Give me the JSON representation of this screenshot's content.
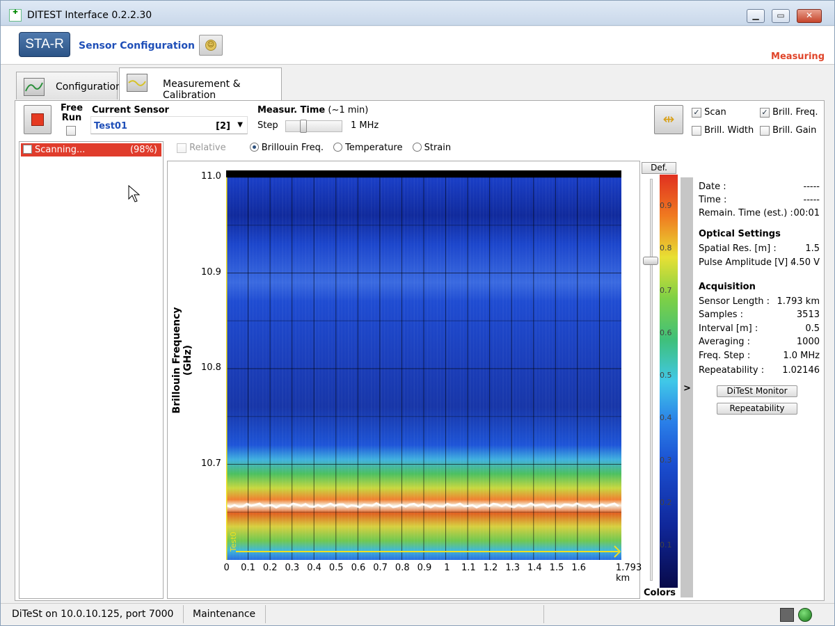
{
  "window": {
    "title": "DITEST Interface 0.2.2.30"
  },
  "header": {
    "brand": "STA-R",
    "section": "Sensor Configuration",
    "status": "Measuring"
  },
  "tabs": [
    {
      "label": "Configuration"
    },
    {
      "label": "Measurement & Calibration",
      "active": true
    }
  ],
  "controls": {
    "free_run_label": "Free Run",
    "current_sensor_label": "Current Sensor",
    "sensor_name": "Test01",
    "sensor_number": "[2]",
    "measur_time_label": "Measur. Time",
    "measur_time_hint": "(~1 min)",
    "step_label": "Step",
    "step_value": "1 MHz"
  },
  "display_options": {
    "scan": {
      "label": "Scan",
      "checked": true
    },
    "brill_freq": {
      "label": "Brill. Freq.",
      "checked": true
    },
    "brill_width": {
      "label": "Brill. Width",
      "checked": false
    },
    "brill_gain": {
      "label": "Brill. Gain",
      "checked": false
    }
  },
  "left_list": {
    "item_label": "Scanning...",
    "item_pct": "(98%)"
  },
  "radios": {
    "relative": "Relative",
    "brillouin": "Brillouin Freq.",
    "temperature": "Temperature",
    "strain": "Strain"
  },
  "chart_data": {
    "type": "heatmap",
    "ylabel": "Brillouin Frequency (GHz)",
    "yticks": [
      "11.0",
      "10.9",
      "10.8",
      "10.7"
    ],
    "ytick_values": [
      11.0,
      10.9,
      10.8,
      10.7
    ],
    "xticks": [
      "0",
      "0.1",
      "0.2",
      "0.3",
      "0.4",
      "0.5",
      "0.6",
      "0.7",
      "0.8",
      "0.9",
      "1",
      "1.1",
      "1.2",
      "1.3",
      "1.4",
      "1.5",
      "1.6",
      "1.793 km"
    ],
    "xtick_values": [
      0,
      0.1,
      0.2,
      0.3,
      0.4,
      0.5,
      0.6,
      0.7,
      0.8,
      0.9,
      1,
      1.1,
      1.2,
      1.3,
      1.4,
      1.5,
      1.6,
      1.793
    ],
    "ylim": [
      10.6,
      11.0
    ],
    "xlim": [
      0,
      1.793
    ],
    "peak_frequency_ghz": 10.657,
    "sensor_tag": "Test0"
  },
  "colorbar": {
    "button": "Def.",
    "label": "Colors",
    "ticks": [
      "0.9",
      "0.8",
      "0.7",
      "0.6",
      "0.5",
      "0.4",
      "0.3",
      "0.2",
      "0.1"
    ]
  },
  "info": {
    "date_label": "Date :",
    "date_value": "-----",
    "time_label": "Time :",
    "time_value": "-----",
    "remain_label": "Remain. Time (est.) :",
    "remain_value": "00:01",
    "optical_head": "Optical Settings",
    "spatial_label": "Spatial Res. [m] :",
    "spatial_value": "1.5",
    "pulse_label": "Pulse Amplitude [V] :",
    "pulse_value": "4.50 V",
    "acq_head": "Acquisition",
    "length_label": "Sensor Length :",
    "length_value": "1.793 km",
    "samples_label": "Samples :",
    "samples_value": "3513",
    "interval_label": "Interval [m] :",
    "interval_value": "0.5",
    "avg_label": "Averaging :",
    "avg_value": "1000",
    "fstep_label": "Freq. Step :",
    "fstep_value": "1.0 MHz",
    "repeat_label": "Repeatability :",
    "repeat_value": "1.02146",
    "monitor_btn": "DiTeSt Monitor",
    "repeat_btn": "Repeatability"
  },
  "statusbar": {
    "connection": "DiTeSt on 10.0.10.125, port 7000",
    "mode": "Maintenance"
  },
  "icons": [
    "app-icon",
    "stop-icon",
    "smile-icon",
    "zoom-icon",
    "network-icon",
    "status-led-icon",
    "config-tab-icon",
    "measurement-tab-icon",
    "cursor-icon"
  ]
}
